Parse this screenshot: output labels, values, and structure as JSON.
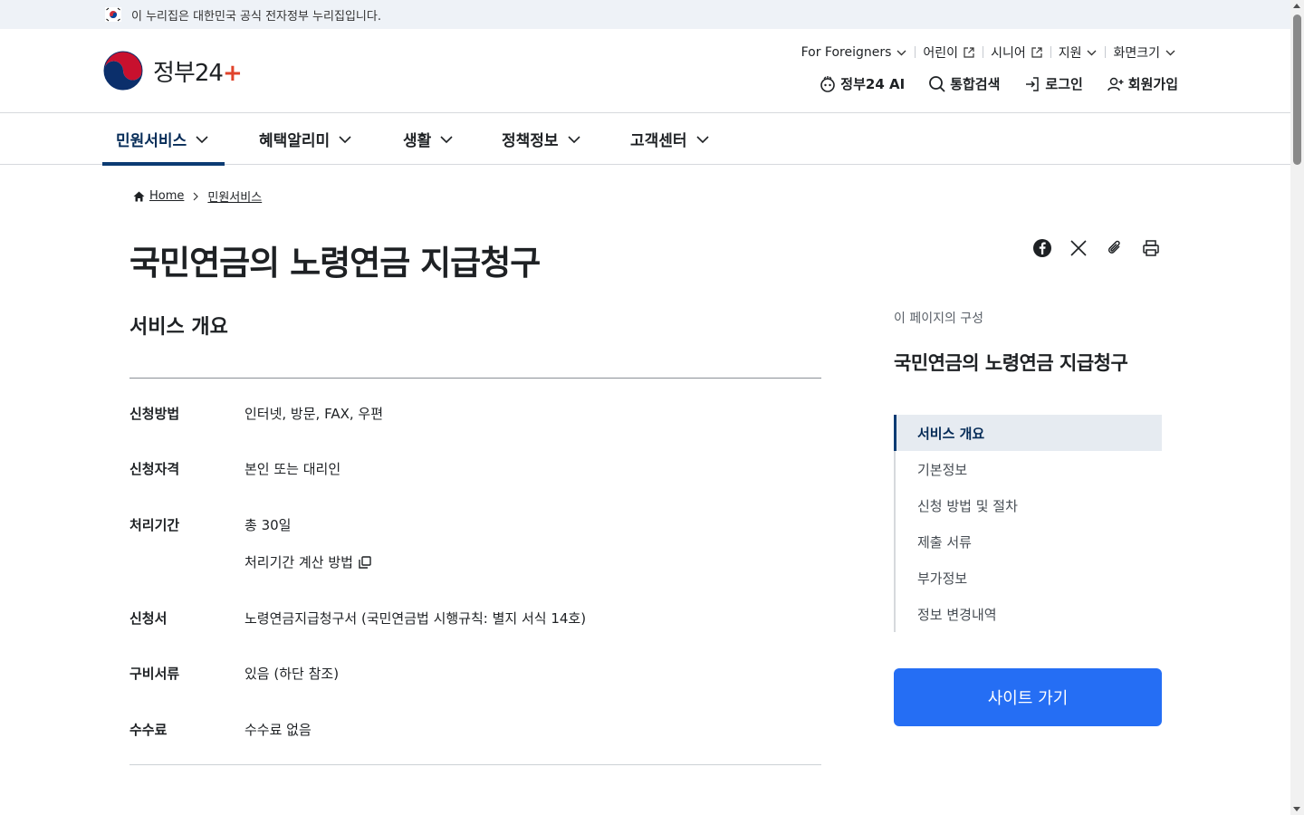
{
  "gov_banner": {
    "text": "이 누리집은 대한민국 공식 전자정부 누리집입니다."
  },
  "logo": {
    "name": "정부24",
    "plus": "+"
  },
  "util_links": {
    "foreigners": "For Foreigners",
    "kids": "어린이",
    "senior": "시니어",
    "support": "지원",
    "zoom": "화면크기"
  },
  "actions": {
    "ai": "정부24 AI",
    "search": "통합검색",
    "login": "로그인",
    "signup": "회원가입"
  },
  "gnb": {
    "items": [
      {
        "label": "민원서비스"
      },
      {
        "label": "혜택알리미"
      },
      {
        "label": "생활"
      },
      {
        "label": "정책정보"
      },
      {
        "label": "고객센터"
      }
    ]
  },
  "breadcrumb": {
    "home": "Home",
    "current": "민원서비스"
  },
  "page": {
    "title": "국민연금의 노령연금 지급청구"
  },
  "overview": {
    "title": "서비스 개요",
    "rows": [
      {
        "key": "신청방법",
        "value": "인터넷, 방문, FAX, 우편"
      },
      {
        "key": "신청자격",
        "value": "본인 또는 대리인"
      },
      {
        "key": "처리기간",
        "value": "총 30일",
        "extra": "처리기간 계산 방법"
      },
      {
        "key": "신청서",
        "value": "노령연금지급청구서 (국민연금법 시행규칙: 별지 서식 14호)"
      },
      {
        "key": "구비서류",
        "value": "있음 (하단 참조)"
      },
      {
        "key": "수수료",
        "value": "수수료 없음"
      }
    ]
  },
  "toc": {
    "label": "이 페이지의 구성",
    "title": "국민연금의 노령연금 지급청구",
    "items": [
      {
        "label": "서비스 개요"
      },
      {
        "label": "기본정보"
      },
      {
        "label": "신청 방법 및 절차"
      },
      {
        "label": "제출 서류"
      },
      {
        "label": "부가정보"
      },
      {
        "label": "정보 변경내역"
      }
    ]
  },
  "site_button": {
    "label": "사이트 가기"
  },
  "colors": {
    "accent": "#256ef4",
    "nav_active": "#0b3b73",
    "banner_bg": "#eef2f7"
  }
}
